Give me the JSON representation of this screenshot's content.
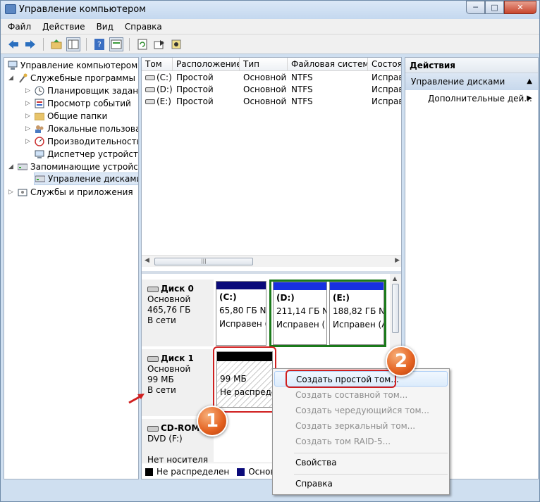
{
  "window": {
    "title": "Управление компьютером",
    "btn_min": "─",
    "btn_max": "□",
    "btn_close": "✕"
  },
  "menu": [
    "Файл",
    "Действие",
    "Вид",
    "Справка"
  ],
  "toolbar_icons": [
    "back-arrow-icon",
    "forward-arrow-icon",
    "up-folder-icon",
    "show-tree-icon",
    "help-icon",
    "properties-icon",
    "refresh-icon",
    "export-icon",
    "settings-icon"
  ],
  "tree": {
    "root": "Управление компьютером (л",
    "tools": "Служебные программы",
    "task_scheduler": "Планировщик заданий",
    "event_viewer": "Просмотр событий",
    "shared_folders": "Общие папки",
    "local_users": "Локальные пользовате",
    "performance": "Производительность",
    "device_manager": "Диспетчер устройств",
    "storage": "Запоминающие устройст",
    "disk_mgmt": "Управление дисками",
    "services": "Службы и приложения"
  },
  "volume_table": {
    "columns": [
      "Том",
      "Расположение",
      "Тип",
      "Файловая система",
      "Состоя"
    ],
    "rows": [
      [
        "(C:)",
        "Простой",
        "Основной",
        "NTFS",
        "Исправ"
      ],
      [
        "(D:)",
        "Простой",
        "Основной",
        "NTFS",
        "Исправ"
      ],
      [
        "(E:)",
        "Простой",
        "Основной",
        "NTFS",
        "Исправ"
      ]
    ]
  },
  "disk0": {
    "name": "Диск 0",
    "type": "Основной",
    "size": "465,76 ГБ",
    "status": "В сети",
    "parts": [
      {
        "label": "(C:)",
        "size": "65,80 ГБ NT",
        "status": "Исправен ("
      },
      {
        "label": "(D:)",
        "size": "211,14 ГБ N",
        "status": "Исправен ("
      },
      {
        "label": "(E:)",
        "size": "188,82 ГБ N",
        "status": "Исправен (А"
      }
    ]
  },
  "disk1": {
    "name": "Диск 1",
    "type": "Основной",
    "size": "99 МБ",
    "status": "В сети",
    "part": {
      "size": "99 МБ",
      "status": "Не распреде"
    }
  },
  "cdrom": {
    "name": "CD-ROM 0",
    "type": "DVD (F:)",
    "status": "Нет носителя"
  },
  "legend": {
    "unalloc": "Не распределен",
    "primary": "Основной"
  },
  "actions": {
    "header": "Действия",
    "section": "Управление дисками",
    "more": "Дополнительные дей..."
  },
  "context_menu": {
    "simple": "Создать простой том...",
    "spanned": "Создать составной том...",
    "striped": "Создать чередующийся том...",
    "mirrored": "Создать зеркальный том...",
    "raid5": "Создать том RAID-5...",
    "properties": "Свойства",
    "help": "Справка"
  },
  "markers": {
    "one": "1",
    "two": "2"
  },
  "colors": {
    "primary_bar": "#0a0a7a",
    "unallocated_bar": "#000000",
    "extended_border": "#1a7a1a",
    "marker": "#e3601f",
    "highlight": "#d01f1f"
  }
}
